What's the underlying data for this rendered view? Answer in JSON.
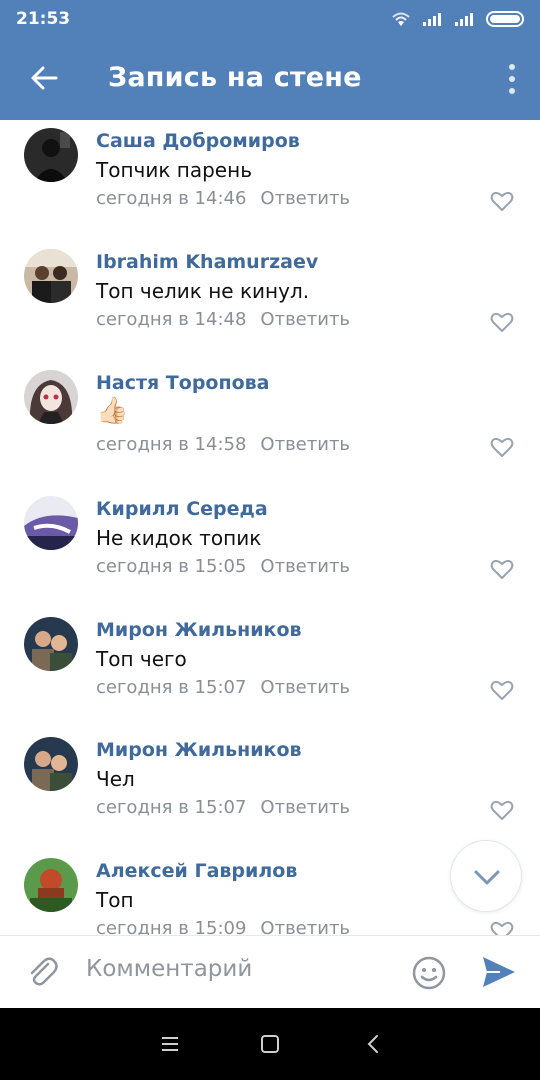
{
  "status_bar": {
    "time": "21:53"
  },
  "header": {
    "title": "Запись на стене"
  },
  "comments": [
    {
      "author": "Саша Добромиров",
      "text": "Топчик парень",
      "time": "сегодня в 14:46",
      "reply_label": "Ответить"
    },
    {
      "author": "Ibrahim Khamurzaev",
      "text": "Топ челик не кинул.",
      "time": "сегодня в 14:48",
      "reply_label": "Ответить"
    },
    {
      "author": "Настя Торопова",
      "text": "👍🏻",
      "time": "сегодня в 14:58",
      "reply_label": "Ответить"
    },
    {
      "author": "Кирилл Середа",
      "text": "Не кидок топик",
      "time": "сегодня в 15:05",
      "reply_label": "Ответить"
    },
    {
      "author": "Мирон Жильников",
      "text": "Топ чего",
      "time": "сегодня в 15:07",
      "reply_label": "Ответить"
    },
    {
      "author": "Мирон Жильников",
      "text": "Чел",
      "time": "сегодня в 15:07",
      "reply_label": "Ответить"
    },
    {
      "author": "Алексей Гаврилов",
      "text": "Топ",
      "time": "сегодня в 15:09",
      "reply_label": "Ответить"
    }
  ],
  "composer": {
    "placeholder": "Комментарий"
  },
  "colors": {
    "header": "#5181b8",
    "author": "#3f6a9b",
    "meta": "#8a8f96",
    "send": "#5181b8"
  },
  "icons": [
    "back-arrow-icon",
    "more-vert-icon",
    "heart-icon",
    "chevron-down-icon",
    "paperclip-icon",
    "smile-icon",
    "send-icon",
    "nav-menu-icon",
    "nav-home-icon",
    "nav-back-icon"
  ]
}
